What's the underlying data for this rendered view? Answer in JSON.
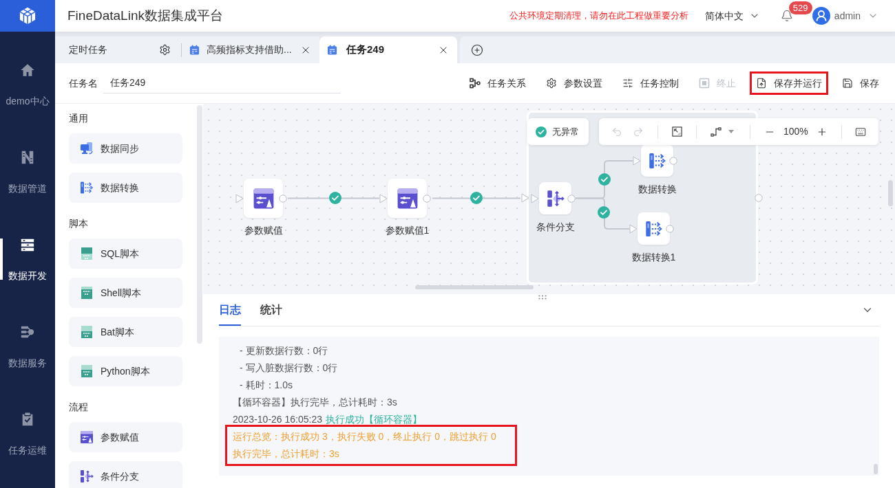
{
  "app": {
    "title": "FineDataLink数据集成平台"
  },
  "header": {
    "notice": "公共环境定期清理，请勿在此工程做重要分析",
    "language": "简体中文",
    "notification_count": "529",
    "user": "admin"
  },
  "nav": {
    "items": [
      {
        "label": "demo中心",
        "selected": false
      },
      {
        "label": "数据管道",
        "selected": false
      },
      {
        "label": "数据开发",
        "selected": true
      },
      {
        "label": "数据服务",
        "selected": false
      },
      {
        "label": "任务运维",
        "selected": false
      }
    ]
  },
  "tabs": [
    {
      "label": "定时任务",
      "kind": "fixed",
      "selected": false
    },
    {
      "label": "高频指标支持借助...",
      "kind": "task",
      "selected": false
    },
    {
      "label": "任务249",
      "kind": "task",
      "selected": true
    }
  ],
  "task": {
    "name_label": "任务名",
    "name_value": "任务249"
  },
  "toolbar": [
    {
      "label": "任务关系",
      "disabled": false,
      "highlighted": false
    },
    {
      "label": "参数设置",
      "disabled": false,
      "highlighted": false
    },
    {
      "label": "任务控制",
      "disabled": false,
      "highlighted": false
    },
    {
      "label": "终止",
      "disabled": true,
      "highlighted": false
    },
    {
      "label": "保存并运行",
      "disabled": false,
      "highlighted": true
    },
    {
      "label": "保存",
      "disabled": false,
      "highlighted": false
    }
  ],
  "palette": {
    "sections": [
      {
        "title": "通用",
        "items": [
          {
            "label": "数据同步",
            "kind": "sync"
          },
          {
            "label": "数据转换",
            "kind": "transform"
          }
        ]
      },
      {
        "title": "脚本",
        "items": [
          {
            "label": "SQL脚本",
            "kind": "sql"
          },
          {
            "label": "Shell脚本",
            "kind": "shell"
          },
          {
            "label": "Bat脚本",
            "kind": "bat"
          },
          {
            "label": "Python脚本",
            "kind": "python"
          }
        ]
      },
      {
        "title": "流程",
        "items": [
          {
            "label": "参数赋值",
            "kind": "assign"
          },
          {
            "label": "条件分支",
            "kind": "branch"
          }
        ]
      }
    ]
  },
  "canvas": {
    "status": "无异常",
    "zoom": "100%",
    "undo": {
      "disabled": true
    },
    "redo": {
      "disabled": true
    },
    "nodes": [
      {
        "label": "参数赋值",
        "kind": "assign"
      },
      {
        "label": "参数赋值1",
        "kind": "assign"
      },
      {
        "label": "条件分支",
        "kind": "branch"
      },
      {
        "label": "数据转换",
        "kind": "transform"
      },
      {
        "label": "数据转换1",
        "kind": "transform"
      }
    ],
    "edges": [
      {
        "passed": true
      },
      {
        "passed": true
      },
      {
        "passed": true
      },
      {
        "passed": true
      }
    ]
  },
  "log": {
    "tabs": [
      {
        "label": "日志",
        "selected": true
      },
      {
        "label": "统计",
        "selected": false
      }
    ],
    "lines": [
      {
        "kind": "detail",
        "text": "- 更新数据行数：0行"
      },
      {
        "kind": "detail",
        "text": "- 写入脏数据行数：0行"
      },
      {
        "kind": "detail",
        "text": "- 耗时：1.0s"
      },
      {
        "kind": "plain",
        "text": "【循环容器】执行完毕，总计耗时：3s"
      },
      {
        "kind": "result",
        "text": "2023-10-26 16:05:23",
        "status": "执行成功【循环容器】"
      }
    ],
    "summary": {
      "highlighted": true,
      "lines": [
        "运行总览：执行成功 3，执行失败 0，终止执行 0，跳过执行 0",
        "执行完毕，总计耗时：3s"
      ]
    }
  }
}
